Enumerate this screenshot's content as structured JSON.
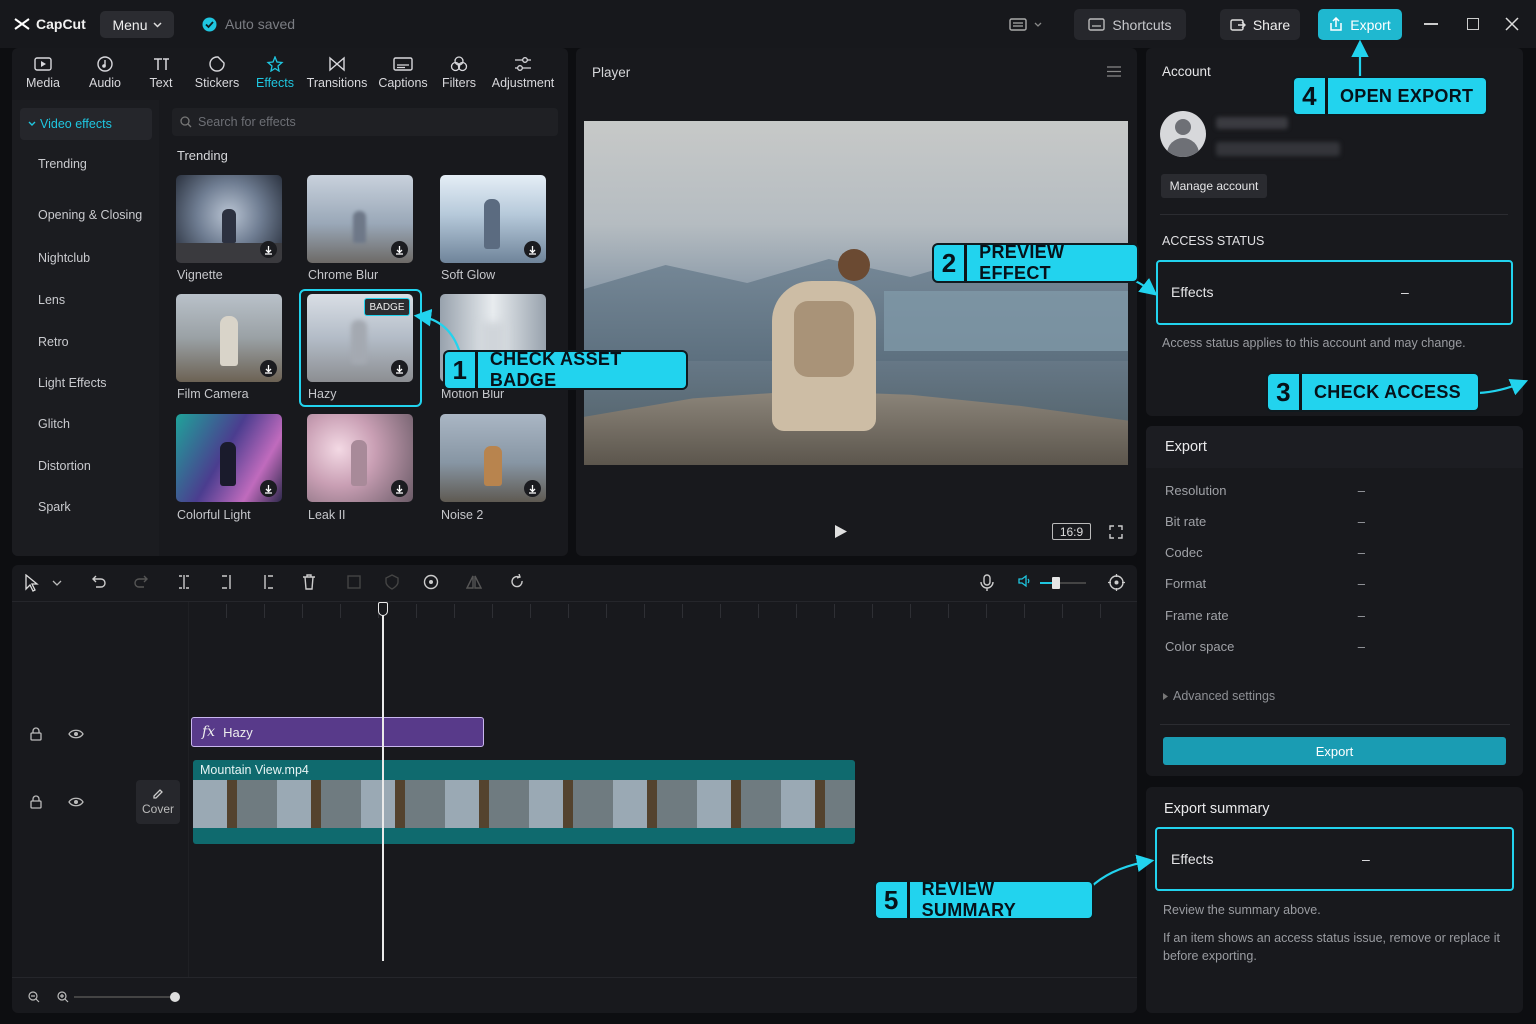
{
  "app": {
    "name": "CapCut",
    "menu_label": "Menu",
    "autosave_label": "Auto saved"
  },
  "titlebar": {
    "shortcuts_label": "Shortcuts",
    "share_label": "Share",
    "export_label": "Export"
  },
  "media_tabs": [
    {
      "label": "Media",
      "icon": "media-icon"
    },
    {
      "label": "Audio",
      "icon": "audio-icon"
    },
    {
      "label": "Text",
      "icon": "text-icon"
    },
    {
      "label": "Stickers",
      "icon": "sticker-icon"
    },
    {
      "label": "Effects",
      "icon": "effects-icon",
      "active": true
    },
    {
      "label": "Transitions",
      "icon": "transitions-icon"
    },
    {
      "label": "Captions",
      "icon": "captions-icon"
    },
    {
      "label": "Filters",
      "icon": "filters-icon"
    },
    {
      "label": "Adjustment",
      "icon": "adjustment-icon"
    }
  ],
  "effects_sidebar": {
    "section": "Video effects",
    "items": [
      "Trending",
      "Opening & Closing",
      "Nightclub",
      "Lens",
      "Retro",
      "Light Effects",
      "Glitch",
      "Distortion",
      "Spark"
    ]
  },
  "search": {
    "placeholder": "Search for effects"
  },
  "effects_grid": {
    "heading": "Trending",
    "items": [
      {
        "name": "Vignette"
      },
      {
        "name": "Chrome Blur"
      },
      {
        "name": "Soft Glow"
      },
      {
        "name": "Film Camera"
      },
      {
        "name": "Hazy",
        "badge": "BADGE",
        "selected": true
      },
      {
        "name": "Motion Blur"
      },
      {
        "name": "Colorful Light"
      },
      {
        "name": "Leak II"
      },
      {
        "name": "Noise 2"
      }
    ]
  },
  "player": {
    "title": "Player",
    "aspect_ratio": "16:9"
  },
  "account": {
    "title": "Account",
    "manage_label": "Manage account",
    "access_status_heading": "ACCESS STATUS",
    "access_item": "Effects",
    "access_value": "–",
    "access_note": "Access status applies to this account and may change."
  },
  "export_panel": {
    "title": "Export",
    "rows": [
      {
        "label": "Resolution",
        "value": "–"
      },
      {
        "label": "Bit rate",
        "value": "–"
      },
      {
        "label": "Codec",
        "value": "–"
      },
      {
        "label": "Format",
        "value": "–"
      },
      {
        "label": "Frame rate",
        "value": "–"
      },
      {
        "label": "Color space",
        "value": "–"
      }
    ],
    "advanced_label": "Advanced settings",
    "export_button": "Export"
  },
  "export_summary": {
    "title": "Export summary",
    "item": "Effects",
    "value": "–",
    "note1": "Review the summary above.",
    "note2": "If an item shows an access status issue, remove or replace it before exporting."
  },
  "timeline": {
    "effect_clip": "Hazy",
    "video_clip": "Mountain View.mp4",
    "cover_label": "Cover"
  },
  "callouts": [
    {
      "num": "1",
      "text": "CHECK ASSET BADGE"
    },
    {
      "num": "2",
      "text": "PREVIEW EFFECT"
    },
    {
      "num": "3",
      "text": "CHECK ACCESS"
    },
    {
      "num": "4",
      "text": "OPEN EXPORT"
    },
    {
      "num": "5",
      "text": "REVIEW SUMMARY"
    }
  ],
  "colors": {
    "accent": "#1fc6e0",
    "callout": "#22d3ee",
    "effect_clip": "#5a3c8c",
    "video_clip": "#0f6f72"
  }
}
